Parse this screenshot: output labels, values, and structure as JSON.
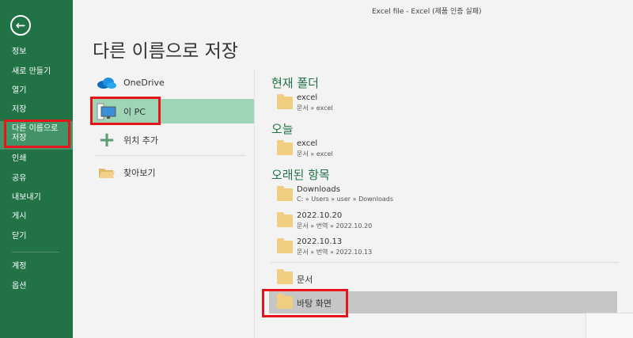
{
  "window_title": "Excel file - Excel (제품 인증 실패)",
  "sidebar": {
    "items": [
      {
        "label": "정보"
      },
      {
        "label": "새로 만들기"
      },
      {
        "label": "열기"
      },
      {
        "label": "저장"
      },
      {
        "label": "다른 이름으로 저장"
      },
      {
        "label": "인쇄"
      },
      {
        "label": "공유"
      },
      {
        "label": "내보내기"
      },
      {
        "label": "게시"
      },
      {
        "label": "닫기"
      },
      {
        "label": "계정"
      },
      {
        "label": "옵션"
      }
    ]
  },
  "page_title": "다른 이름으로 저장",
  "locations": [
    {
      "label": "OneDrive",
      "icon": "cloud-icon"
    },
    {
      "label": "이 PC",
      "icon": "computer-icon"
    },
    {
      "label": "위치 추가",
      "icon": "plus-icon"
    },
    {
      "label": "찾아보기",
      "icon": "folder-open-icon"
    }
  ],
  "sections": {
    "current": {
      "heading": "현재 폴더",
      "items": [
        {
          "name": "excel",
          "path": "문서 » excel"
        }
      ]
    },
    "today": {
      "heading": "오늘",
      "items": [
        {
          "name": "excel",
          "path": "문서 » excel"
        }
      ]
    },
    "older": {
      "heading": "오래된 항목",
      "items": [
        {
          "name": "Downloads",
          "path": "C: » Users » user » Downloads"
        },
        {
          "name": "2022.10.20",
          "path": "문서 » 번역 » 2022.10.20"
        },
        {
          "name": "2022.10.13",
          "path": "문서 » 번역 » 2022.10.13"
        }
      ]
    }
  },
  "pinned": [
    {
      "name": "문서"
    },
    {
      "name": "바탕 화면"
    }
  ],
  "colors": {
    "accent": "#217346",
    "selected": "#9fd5b7",
    "highlight": "#e8141c"
  }
}
